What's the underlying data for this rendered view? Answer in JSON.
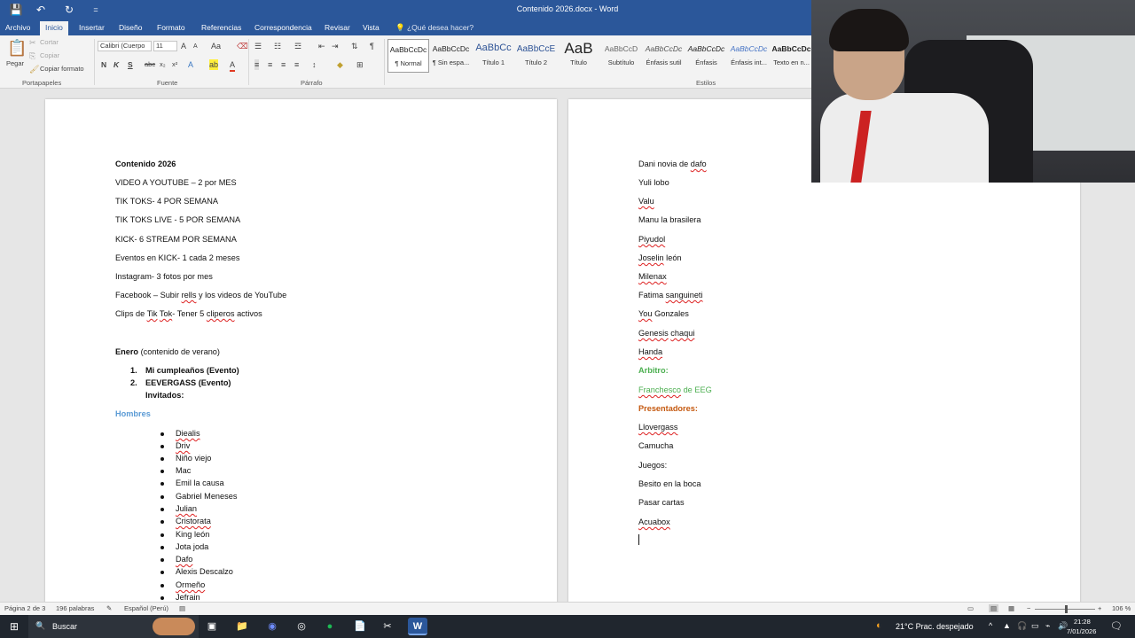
{
  "window": {
    "title": "Contenido 2026.docx - Word",
    "quick_access": {
      "save": "💾",
      "undo": "↶",
      "redo": "↻",
      "customize": "="
    }
  },
  "ribbon": {
    "tabs": [
      {
        "label": "Archivo"
      },
      {
        "label": "Inicio"
      },
      {
        "label": "Insertar"
      },
      {
        "label": "Diseño"
      },
      {
        "label": "Formato"
      },
      {
        "label": "Referencias"
      },
      {
        "label": "Correspondencia"
      },
      {
        "label": "Revisar"
      },
      {
        "label": "Vista"
      }
    ],
    "active_tab": "Inicio",
    "tell_me": "¿Qué desea hacer?",
    "clipboard": {
      "paste": "Pegar",
      "cut": "Cortar",
      "copy": "Copiar",
      "format_painter": "Copiar formato",
      "group": "Portapapeles"
    },
    "font": {
      "family": "Calibri (Cuerpo",
      "size": "11",
      "group": "Fuente",
      "bold": "N",
      "italic": "K",
      "underline": "S",
      "strike": "abc",
      "subscript": "x₂",
      "superscript": "x²",
      "grow": "A",
      "shrink": "A",
      "case": "Aa"
    },
    "paragraph": {
      "group": "Párrafo"
    },
    "styles": {
      "group": "Estilos",
      "items": [
        {
          "sample": "AaBbCcDc",
          "name": "¶ Normal"
        },
        {
          "sample": "AaBbCcDc",
          "name": "¶ Sin espa..."
        },
        {
          "sample": "AaBbCc",
          "name": "Título 1"
        },
        {
          "sample": "AaBbCcE",
          "name": "Título 2"
        },
        {
          "sample": "AaB",
          "name": "Título"
        },
        {
          "sample": "AaBbCcD",
          "name": "Subtítulo"
        },
        {
          "sample": "AaBbCcDc",
          "name": "Énfasis sutil"
        },
        {
          "sample": "AaBbCcDc",
          "name": "Énfasis"
        },
        {
          "sample": "AaBbCcDc",
          "name": "Énfasis int..."
        },
        {
          "sample": "AaBbCcDc",
          "name": "Texto en n..."
        }
      ]
    }
  },
  "document": {
    "left_page": {
      "title": "Contenido 2026",
      "lines": [
        "VIDEO A YOUTUBE – 2 por MES",
        "TIK TOKS- 4 POR SEMANA",
        "TIK TOKS LIVE - 5 POR SEMANA",
        "KICK- 6 STREAM POR SEMANA",
        "Eventos en KICK-  1 cada 2 meses",
        "Instagram- 3 fotos por mes"
      ],
      "facebook": {
        "a": "Facebook – Subir ",
        "b": "rells",
        "c": " y los videos de YouTube"
      },
      "clips": {
        "a": "Clips de ",
        "b": "Tik",
        "c": " ",
        "d": "Tok",
        "e": "- Tener 5 ",
        "f": "cliperos",
        "g": " activos"
      },
      "enero": {
        "bold": "Enero",
        "rest": " (contenido de verano)"
      },
      "numbered": [
        {
          "num": "1.",
          "text": "Mi cumpleaños (Evento)"
        },
        {
          "num": "2.",
          "text": "EEVERGASS (Evento)"
        }
      ],
      "invitados": "Invitados:",
      "hombres": "Hombres",
      "bullets": [
        {
          "text": "Diealis"
        },
        {
          "text": "Driv"
        },
        {
          "text": "Niño viejo"
        },
        {
          "text": "Mac"
        },
        {
          "text": "Emil la causa"
        },
        {
          "text": "Gabriel Meneses"
        },
        {
          "text": "Julian"
        },
        {
          "text": "Cristorata"
        },
        {
          "text": "King león"
        },
        {
          "text": "Jota joda"
        },
        {
          "text": "Dafo"
        },
        {
          "text": "Alexis Descalzo"
        },
        {
          "text": "Ormeño"
        },
        {
          "text": "Jefrain"
        }
      ]
    },
    "right_page": {
      "dani": {
        "a": "Dani novia de ",
        "b": "dafo"
      },
      "yuli": "Yuli lobo",
      "valu": "Valu",
      "manu": "Manu la brasilera",
      "piyudol": "Piyudol",
      "joselin": {
        "a": "Joselin",
        "b": " león"
      },
      "milenax": "Milenax",
      "fatima": {
        "a": "Fatima ",
        "b": "sanguineti"
      },
      "you": {
        "a": "You",
        "b": " Gonzales"
      },
      "genesis": {
        "a": "Genesis",
        "b": " ",
        "c": "chaqui"
      },
      "handa": "Handa",
      "arbitro": "Arbitro:",
      "franchesco": {
        "a": "Franchesco",
        "b": " de EEG"
      },
      "presentadores": "Presentadores:",
      "llovergass": "Llovergass",
      "camucha": "Camucha",
      "juegos": "Juegos:",
      "besito": "Besito en la boca",
      "pasar": "Pasar cartas",
      "acuabox": "Acuabox"
    }
  },
  "statusbar": {
    "page": "Página 2 de 3",
    "words": "196 palabras",
    "language": "Español (Perú)",
    "zoom": "106 %",
    "minus": "−",
    "plus": "+"
  },
  "taskbar": {
    "search": "Buscar",
    "weather": "21°C  Prac. despejado",
    "time": "21:28",
    "date": "7/01/2026"
  }
}
